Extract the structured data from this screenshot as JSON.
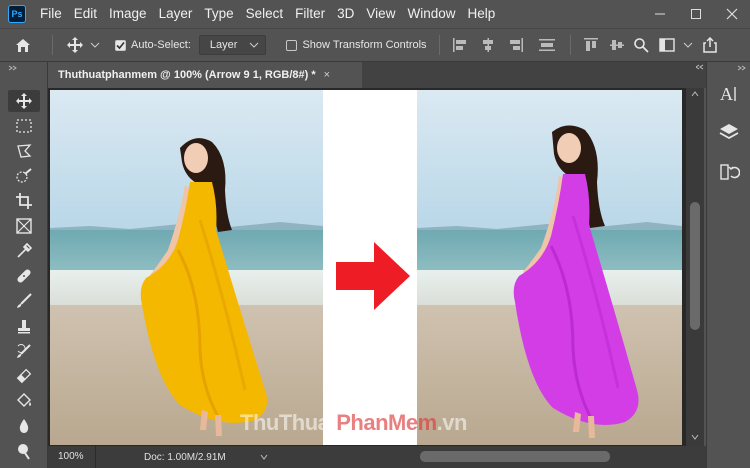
{
  "app": {
    "logo_text": "Ps",
    "accent": "#31a8ff"
  },
  "menu": [
    "File",
    "Edit",
    "Image",
    "Layer",
    "Type",
    "Select",
    "Filter",
    "3D",
    "View",
    "Window",
    "Help"
  ],
  "options_bar": {
    "auto_select_label": "Auto-Select:",
    "auto_select_checked": true,
    "auto_select_target": "Layer",
    "show_transform_label": "Show Transform Controls",
    "show_transform_checked": false
  },
  "document": {
    "tab_title": "Thuthuatphanmem @ 100% (Arrow 9 1, RGB/8#) *",
    "close_glyph": "×"
  },
  "status": {
    "zoom": "100%",
    "doc_size": "Doc: 1.00M/2.91M"
  },
  "canvas": {
    "left_dress_color": "#f5b800",
    "right_dress_color": "#d23de6",
    "arrow_color": "#ee1c24"
  },
  "watermark": {
    "part1": "Thu",
    "part2": "Thuat",
    "part3": "PhanMem",
    "part4": ".vn"
  },
  "tools": [
    "move-tool",
    "marquee-tool",
    "lasso-tool",
    "quick-selection-tool",
    "crop-tool",
    "frame-tool",
    "eyedropper-tool",
    "healing-brush-tool",
    "brush-tool",
    "clone-stamp-tool",
    "history-brush-tool",
    "eraser-tool",
    "gradient-tool",
    "blur-tool",
    "dodge-tool"
  ],
  "right_panel": [
    "character-panel",
    "layers-panel",
    "history-panel"
  ]
}
